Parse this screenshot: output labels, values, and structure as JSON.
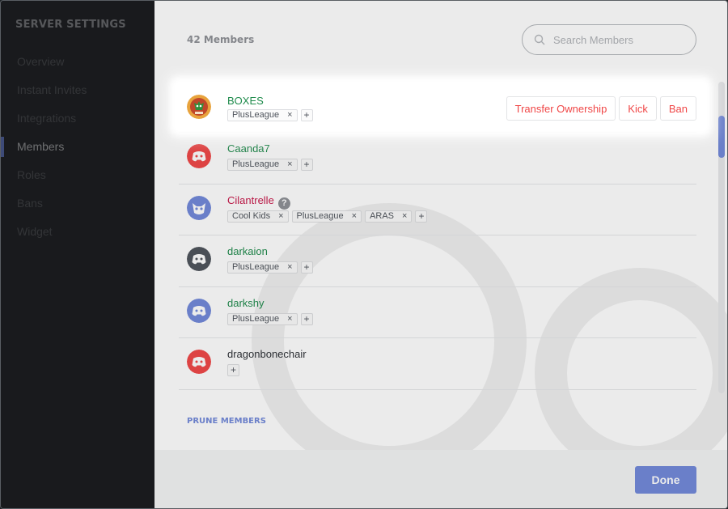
{
  "sidebar": {
    "title": "SERVER SETTINGS",
    "items": [
      {
        "label": "Overview"
      },
      {
        "label": "Instant Invites"
      },
      {
        "label": "Integrations"
      },
      {
        "label": "Members"
      },
      {
        "label": "Roles"
      },
      {
        "label": "Bans"
      },
      {
        "label": "Widget"
      }
    ],
    "active": "Members"
  },
  "header": {
    "members_count": "42 Members",
    "search_placeholder": "Search Members"
  },
  "highlighted_member": {
    "name": "BOXES",
    "name_color": "#1f8b4c",
    "roles": [
      "PlusLeague"
    ],
    "actions": [
      "Transfer Ownership",
      "Kick",
      "Ban"
    ]
  },
  "members": [
    {
      "name": "Caanda7",
      "name_color": "#1f8b4c",
      "avatar_color": "#f04747",
      "roles": [
        "PlusLeague"
      ],
      "help": false
    },
    {
      "name": "Cilantrelle",
      "name_color": "#c9184a",
      "avatar_color": "#7289da",
      "roles": [
        "Cool Kids",
        "PlusLeague",
        "ARAS"
      ],
      "help": true
    },
    {
      "name": "darkaion",
      "name_color": "#1f8b4c",
      "avatar_color": "#747f8d",
      "roles": [
        "PlusLeague"
      ],
      "help": false
    },
    {
      "name": "darkshy",
      "name_color": "#1f8b4c",
      "avatar_color": "#7289da",
      "roles": [
        "PlusLeague"
      ],
      "help": false
    },
    {
      "name": "dragonbonechair",
      "name_color": "#2e3136",
      "avatar_color": "#f04747",
      "roles": [],
      "help": false
    }
  ],
  "role_remove_symbol": "×",
  "role_add_symbol": "+",
  "help_symbol": "?",
  "prune_label": "PRUNE MEMBERS",
  "done_label": "Done",
  "colors": {
    "accent": "#7289da",
    "danger": "#f04747",
    "sidebar_bg": "#2e3136"
  }
}
